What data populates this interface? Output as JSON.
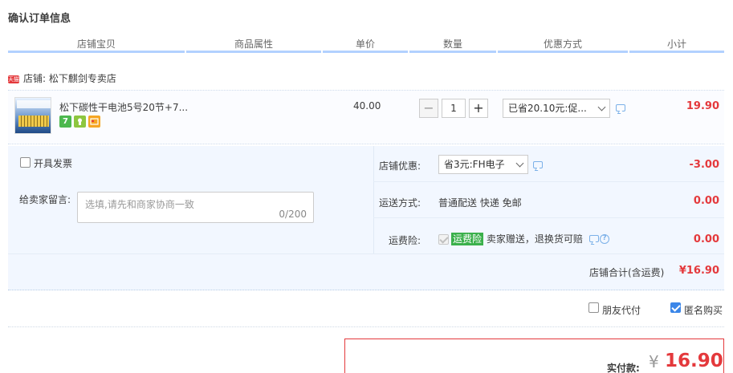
{
  "page_title": "确认订单信息",
  "columns": [
    "店铺宝贝",
    "商品属性",
    "单价",
    "数量",
    "优惠方式",
    "小计"
  ],
  "shop": {
    "badge": "天猫",
    "label": "店铺: 松下麒剑专卖店"
  },
  "item": {
    "name": "松下碳性干电池5号20节+7...",
    "icons": [
      "7",
      "tmall-service-icon",
      "card-icon"
    ],
    "unit_price": "40.00",
    "quantity": "1",
    "qty_minus": "−",
    "qty_plus": "+",
    "discount_select": "已省20.10元:促...",
    "subtotal": "19.90"
  },
  "invoice": {
    "label": "开具发票",
    "checked": false
  },
  "message": {
    "label": "给卖家留言:",
    "placeholder": "选填,请先和商家协商一致",
    "counter": "0/200"
  },
  "shop_discount": {
    "label": "店铺优惠:",
    "select": "省3元:FH电子",
    "amount": "-3.00"
  },
  "shipping": {
    "label": "运送方式:",
    "value": "普通配送 快递 免邮",
    "amount": "0.00"
  },
  "insurance": {
    "label": "运费险:",
    "badge": "运费险",
    "desc": "卖家赠送，退换货可赔",
    "help": "?",
    "amount": "0.00"
  },
  "shop_total": {
    "label": "店铺合计(含运费)",
    "value": "¥16.90"
  },
  "options": {
    "friend_pay": "朋友代付",
    "anonymous": "匿名购买",
    "friend_pay_checked": false,
    "anonymous_checked": true
  },
  "payment": {
    "label": "实付款:",
    "currency": "¥",
    "amount": "16.90"
  },
  "colors": {
    "accent_red": "#e4393c",
    "header_underline": "#b2d1ff",
    "panel_bg": "#f2f7ff",
    "green_badge": "#3bb04b",
    "checkbox_blue": "#3b86e8"
  }
}
